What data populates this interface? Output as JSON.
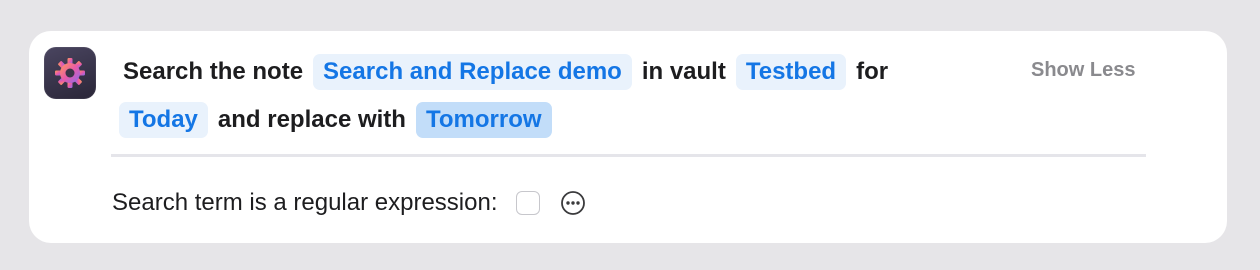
{
  "action": {
    "app_icon": "gear-icon",
    "summary": {
      "prefix": "Search the note",
      "note_name": "Search and Replace demo",
      "in_vault": "in vault",
      "vault_name": "Testbed",
      "for": "for",
      "search_term": "Today",
      "replace_with": "and replace with",
      "replacement": "Tomorrow"
    },
    "show_less_label": "Show Less"
  },
  "parameters": {
    "regex_label": "Search term is a regular expression:",
    "regex_checked": false,
    "more_icon": "ellipsis-circle-icon"
  },
  "colors": {
    "token_text": "#1476e5",
    "token_bg": "#e9f2fc",
    "token_selected_bg": "#c2ddf9",
    "show_less": "#8a8a8e"
  }
}
